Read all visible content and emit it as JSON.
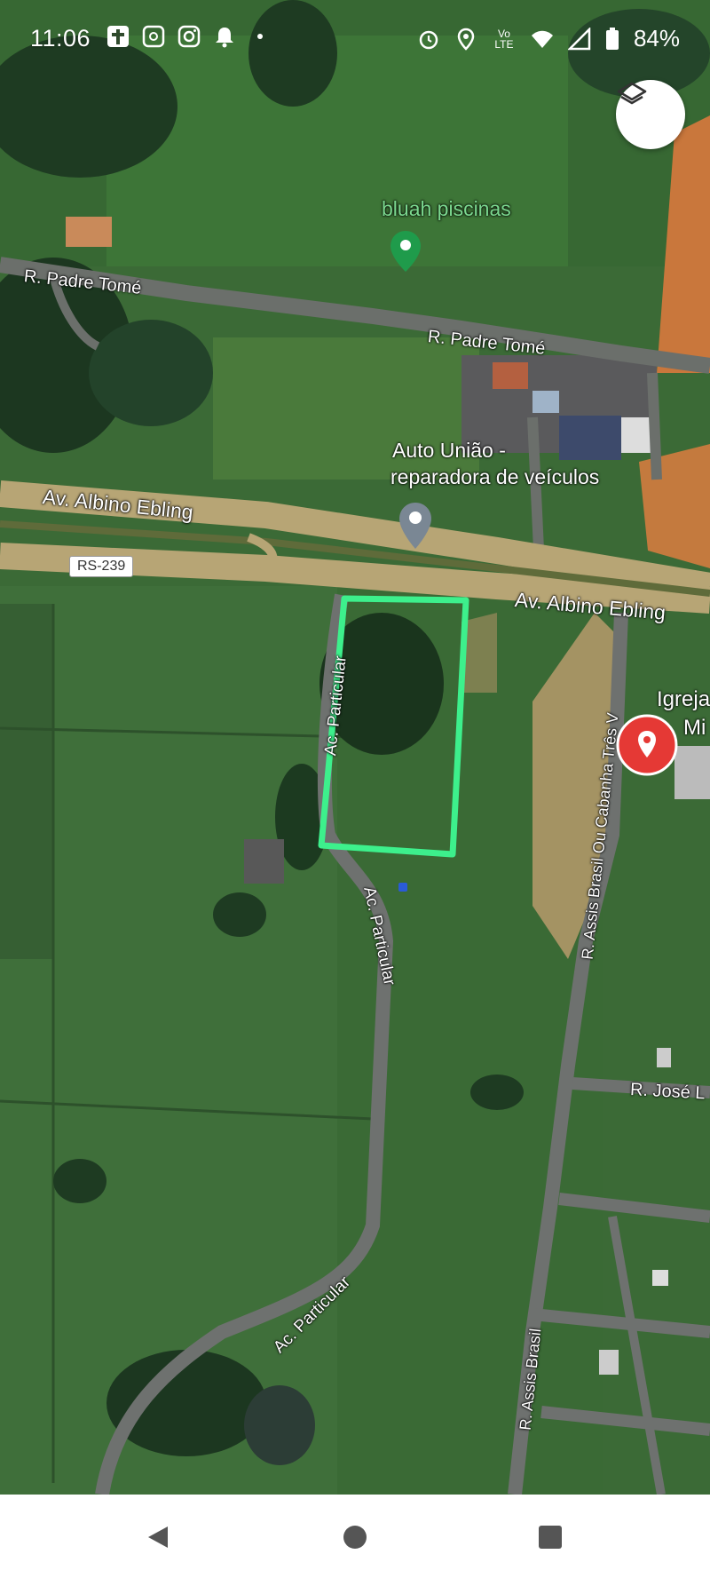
{
  "status_bar": {
    "time": "11:06",
    "network": "Vo LTE",
    "battery": "84%"
  },
  "map": {
    "layers_icon": "layers-icon",
    "places": [
      {
        "name": "bluah piscinas",
        "pin": "green-pin-icon",
        "color": "#7bd88f"
      },
      {
        "name": "Auto União - reparadora de veículos",
        "line1": "Auto União -",
        "line2": "reparadora de veículos",
        "pin": "gray-pin-icon",
        "color": "#ffffff"
      },
      {
        "name": "Igreja Mi",
        "line1": "Igreja",
        "line2": "Mi",
        "pin": "red-pin-icon",
        "color": "#ffffff"
      }
    ],
    "roads": {
      "padre_tome_1": "R. Padre Tomé",
      "padre_tome_2": "R. Padre Tomé",
      "albino_1": "Av. Albino Ebling",
      "albino_2": "Av. Albino Ebling",
      "route_shield": "RS-239",
      "particular_1": "Ac. Particular",
      "particular_2": "Ac. Particular",
      "particular_3": "Ac. Particular",
      "assis_1": "R. Assis Brasil Ou Cabanha Três V",
      "assis_2": "R. Assis Brasil",
      "jose": "R. José L"
    },
    "highlight_color": "#3df08c"
  },
  "navbar": {
    "back_icon": "back-triangle-icon",
    "home_icon": "home-circle-icon",
    "recents_icon": "recents-square-icon"
  }
}
